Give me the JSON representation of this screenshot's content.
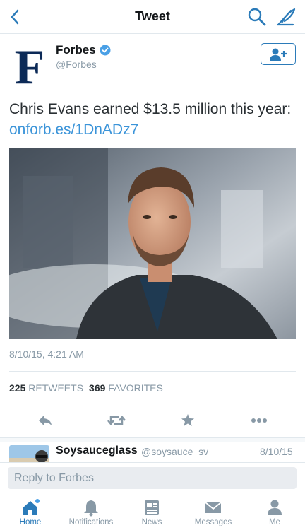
{
  "navbar": {
    "title": "Tweet"
  },
  "author": {
    "name": "Forbes",
    "handle": "@Forbes",
    "logo_letter": "F",
    "verified": true
  },
  "tweet": {
    "text": "Chris Evans earned $13.5 million this year: ",
    "link": "onforb.es/1DnADz7",
    "timestamp": "8/10/15, 4:21 AM",
    "retweets": "225",
    "retweets_label": "RETWEETS",
    "favorites": "369",
    "favorites_label": "FAVORITES"
  },
  "reply": {
    "name": "Soysauceglass",
    "handle": "@soysauce_sv",
    "time": "8/10/15"
  },
  "reply_box": {
    "placeholder": "Reply to Forbes"
  },
  "tabs": [
    {
      "label": "Home",
      "icon": "home-icon",
      "active": true
    },
    {
      "label": "Notifications",
      "icon": "bell-icon"
    },
    {
      "label": "News",
      "icon": "news-icon"
    },
    {
      "label": "Messages",
      "icon": "envelope-icon"
    },
    {
      "label": "Me",
      "icon": "person-icon"
    }
  ],
  "colors": {
    "accent": "#2b7bb9",
    "link": "#3b94d9",
    "muted": "#8899a6",
    "forbes_blue": "#0c2a57"
  }
}
